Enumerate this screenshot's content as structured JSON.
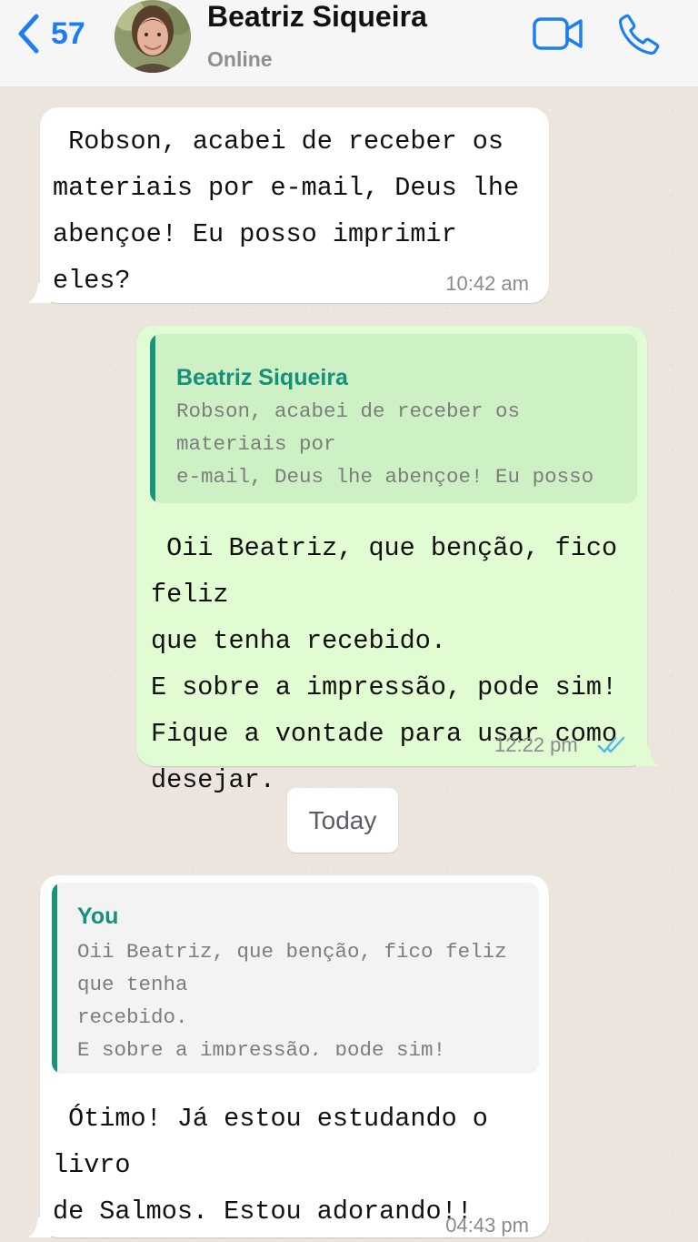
{
  "header": {
    "back_count": "57",
    "contact_name": "Beatriz Siqueira",
    "status": "Online",
    "accent_color": "#1b7ff2"
  },
  "messages": [
    {
      "direction": "incoming",
      "text": " Robson, acabei de receber os\nmateriais por e-mail, Deus lhe\nabençoe! Eu posso imprimir eles?",
      "time": "10:42 am"
    },
    {
      "direction": "outgoing",
      "quote": {
        "author": "Beatriz Siqueira",
        "text": "Robson, acabei de receber os materiais por\ne-mail, Deus lhe abençoe! Eu posso\nimprimir eles?"
      },
      "text": " Oii Beatriz, que benção, fico feliz\nque tenha recebido.\nE sobre a impressão, pode sim!\nFique a vontade para usar como\ndesejar.",
      "time": "12:22 pm",
      "status_icon": "double-check-icon"
    },
    {
      "direction": "incoming",
      "quote": {
        "author": "You",
        "text": "Oii Beatriz, que benção, fico feliz que tenha\nrecebido.\nE sobre a impressão, pode sim! Inclusive, a\nmaioria dos nossos"
      },
      "text": " Ótimo! Já estou estudando o livro\nde Salmos. Estou adorando!!\nObrigada.",
      "time": "04:43 pm"
    }
  ],
  "date_separator": "Today",
  "colors": {
    "incoming_bubble": "#ffffff",
    "outgoing_bubble": "#e1fbd3",
    "quote_accent": "#17957b",
    "read_ticks": "#4fb6ec"
  }
}
